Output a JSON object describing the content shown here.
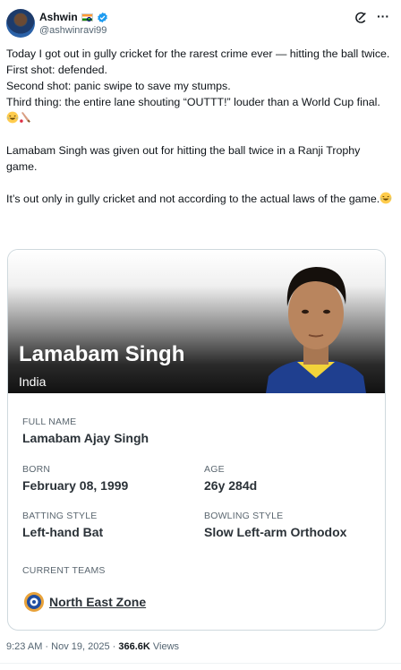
{
  "author": {
    "name": "Ashwin",
    "handle": "@ashwinravi99"
  },
  "tweet": {
    "lines": [
      "Today I got out in gully cricket for the rarest crime ever — hitting the ball twice.",
      "First shot: defended.",
      "Second shot: panic swipe to save my stumps.",
      "Third thing: the entire lane shouting “OUTTT!” louder than a World Cup final.",
      "Lamabam Singh was given out for hitting the ball twice in a Ranji Trophy game.",
      "It’s out only in gully cricket and not according to the actual laws of the game."
    ]
  },
  "card": {
    "player_name": "Lamabam Singh",
    "country": "India",
    "full_name_label": "FULL NAME",
    "full_name": "Lamabam Ajay Singh",
    "born_label": "BORN",
    "born": "February 08, 1999",
    "age_label": "AGE",
    "age": "26y 284d",
    "batting_label": "BATTING STYLE",
    "batting": "Left-hand Bat",
    "bowling_label": "BOWLING STYLE",
    "bowling": "Slow Left-arm Orthodox",
    "teams_label": "CURRENT TEAMS",
    "team": "North East Zone"
  },
  "meta": {
    "time_date": "9:23 AM · Nov 19, 2025 · ",
    "views_count": "366.6K",
    "views_label": " Views"
  },
  "icons": [
    "avatar",
    "india-flag-icon",
    "verified-badge-icon",
    "grok-icon",
    "more-icon",
    "laughing-emoji-icon",
    "cricket-bat-emoji-icon",
    "bcci-logo-icon"
  ],
  "colors": {
    "verified": "#1d9bf0",
    "text": "#0f1419",
    "secondary": "#536471"
  }
}
